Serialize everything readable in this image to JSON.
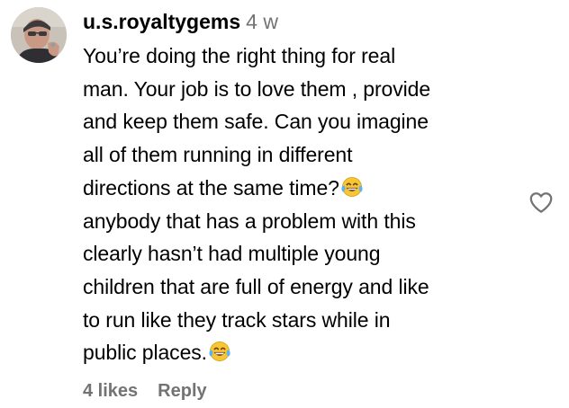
{
  "comment": {
    "username": "u.s.royaltygems",
    "time_ago": "4 w",
    "lines": [
      "You’re doing the right thing for real",
      "man. Your job is to love them , provide",
      "and keep them safe. Can you imagine",
      "all of them running in different",
      "directions at the same time?",
      "anybody that has a problem with this",
      "clearly hasn’t had multiple young",
      "children that are full of energy and like",
      "to run like they track stars while in",
      "public places."
    ],
    "emoji": "face-with-tears-of-joy",
    "likes_label": "4 likes",
    "reply_label": "Reply",
    "like_icon": "heart-outline-icon"
  },
  "colors": {
    "text": "#000000",
    "secondary": "#737373",
    "background": "#ffffff"
  }
}
